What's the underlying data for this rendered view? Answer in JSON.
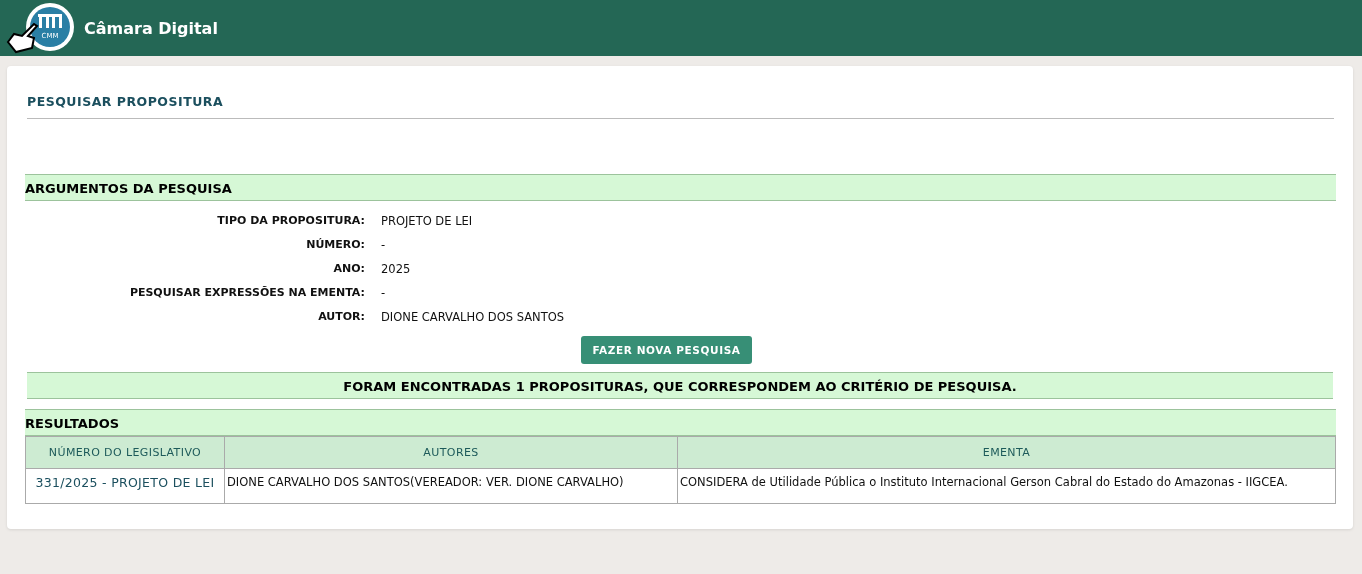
{
  "header": {
    "logo_text": "CMM",
    "title": "Câmara Digital"
  },
  "page_title": "PESQUISAR PROPOSITURA",
  "arguments": {
    "heading": "ARGUMENTOS DA PESQUISA",
    "fields": [
      {
        "label": "TIPO DA PROPOSITURA:",
        "value": "PROJETO DE LEI"
      },
      {
        "label": "NÚMERO:",
        "value": "-"
      },
      {
        "label": "ANO:",
        "value": "2025"
      },
      {
        "label": "PESQUISAR EXPRESSÕES NA EMENTA:",
        "value": "-"
      },
      {
        "label": "AUTOR:",
        "value": "DIONE CARVALHO DOS SANTOS"
      }
    ],
    "button": "FAZER NOVA PESQUISA"
  },
  "found_message": "FORAM ENCONTRADAS 1 PROPOSITURAS, QUE CORRESPONDEM AO CRITÉRIO DE PESQUISA.",
  "results": {
    "heading": "RESULTADOS",
    "table": {
      "columns": [
        "NÚMERO DO LEGISLATIVO",
        "AUTORES",
        "EMENTA"
      ],
      "rows": [
        [
          "331/2025 - PROJETO DE LEI",
          "DIONE CARVALHO DOS SANTOS(VEREADOR: VER. DIONE CARVALHO)",
          "CONSIDERA de Utilidade Pública o Instituto Internacional Gerson Cabral do Estado do Amazonas - IIGCEA."
        ]
      ]
    }
  }
}
